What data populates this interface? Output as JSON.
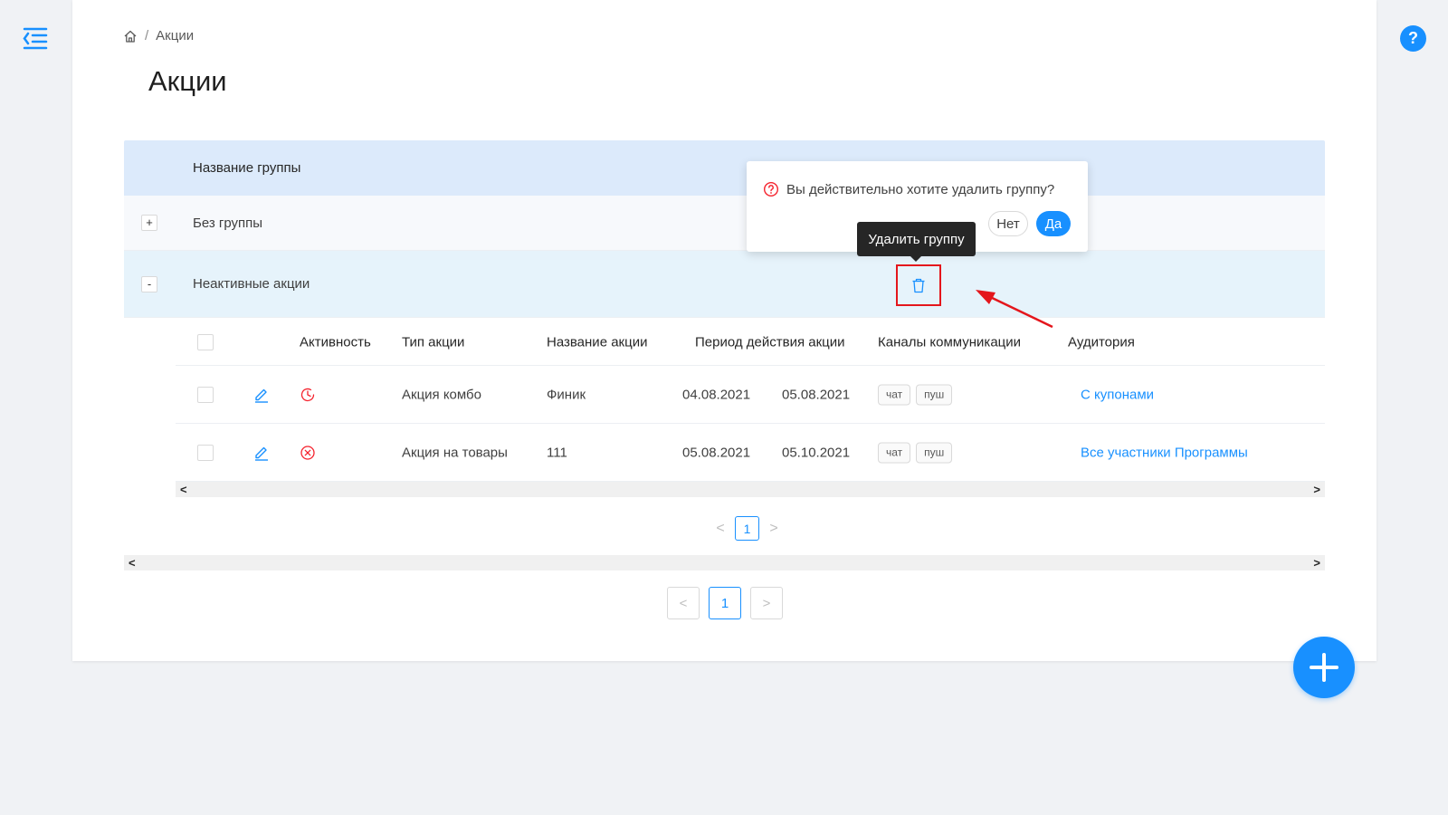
{
  "breadcrumb": {
    "current": "Акции",
    "separator": "/"
  },
  "page": {
    "title": "Акции"
  },
  "help": {
    "label": "?"
  },
  "groups_table": {
    "header": "Название группы",
    "groups": [
      {
        "toggle": "+",
        "name": "Без группы"
      },
      {
        "toggle": "-",
        "name": "Неактивные акции"
      }
    ]
  },
  "promotions": {
    "columns": {
      "activity": "Активность",
      "type": "Тип акции",
      "name": "Название акции",
      "period": "Период действия акции",
      "channels": "Каналы коммуникации",
      "audience": "Аудитория"
    },
    "rows": [
      {
        "status_icon": "clock-icon",
        "type": "Акция комбо",
        "name": "Финик",
        "start": "04.08.2021",
        "end": "05.08.2021",
        "channels": [
          "чат",
          "пуш"
        ],
        "audience": "С купонами"
      },
      {
        "status_icon": "close-circle-icon",
        "type": "Акция на товары",
        "name": "111",
        "start": "05.08.2021",
        "end": "05.10.2021",
        "channels": [
          "чат",
          "пуш"
        ],
        "audience": "Все участники Программы"
      }
    ]
  },
  "pagination_inner": {
    "prev": "<",
    "page": "1",
    "next": ">"
  },
  "pagination_outer": {
    "prev": "<",
    "page": "1",
    "next": ">"
  },
  "scroll_arrows": {
    "left": "<",
    "right": ">"
  },
  "popconfirm": {
    "message": "Вы действительно хотите удалить группу?",
    "no": "Нет",
    "yes": "Да"
  },
  "tooltip": {
    "text": "Удалить группу"
  },
  "colors": {
    "primary": "#1890ff",
    "annotation": "#e4161c",
    "warning": "#f5222d"
  }
}
